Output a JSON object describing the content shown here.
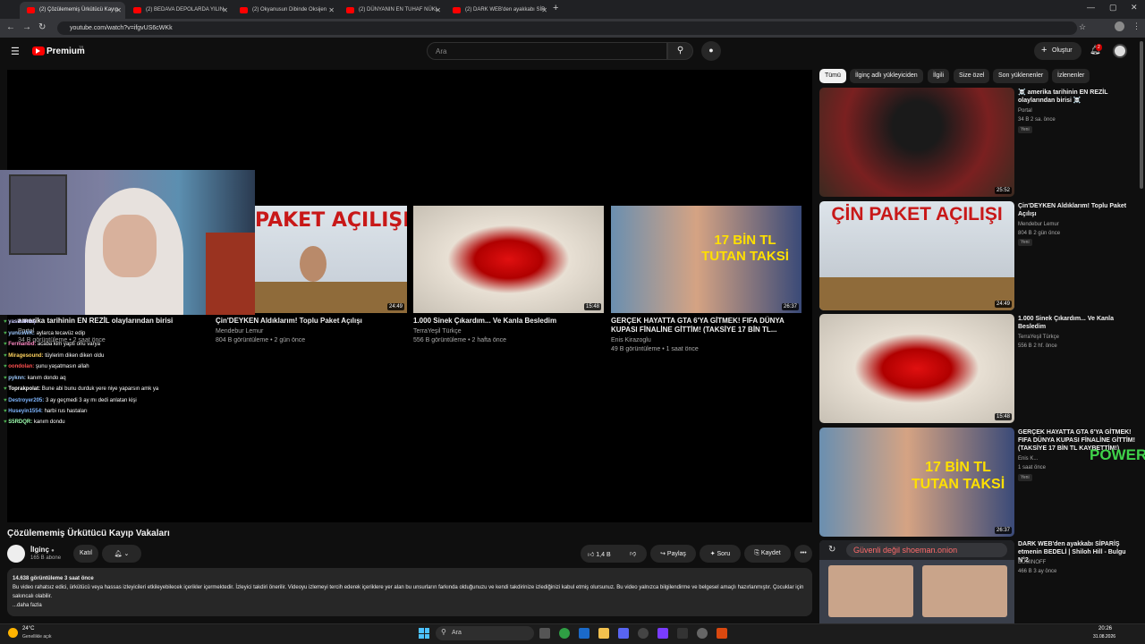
{
  "browser": {
    "tabs": [
      {
        "label": "(2) Çözülememiş Ürkütücü Kayıp"
      },
      {
        "label": "(2) BEDAVA DEPOLARDA YILIN"
      },
      {
        "label": "(2) Okyanusun Dibinde Oksijen"
      },
      {
        "label": "(2) DÜNYANIN EN TUHAF NÜKL"
      },
      {
        "label": "(2) DARK WEB'den ayakkabı SİP"
      }
    ],
    "new_tab": "+",
    "url": "youtube.com/watch?v=ifgvUS6cWKk"
  },
  "yt_header": {
    "logo": "Premium",
    "logo_sup": "TR",
    "search_placeholder": "Ara",
    "create_label": "Oluştur",
    "notif_count": "2"
  },
  "endscreen": [
    {
      "title": "Çin'DEYKEN Aldıklarım! Toplu Paket Açılışı",
      "meta": "804 B görüntüleme • 2 gün önce",
      "channel": "Mendebur Lemur",
      "duration": "24:49",
      "thumb_text": "PAKET AÇILIŞI"
    },
    {
      "title": "1.000 Sinek Çıkardım... Ve Kanla Besledim",
      "meta": "556 B görüntüleme • 2 hafta önce",
      "channel": "TerraYeşil Türkçe",
      "duration": "15:48"
    },
    {
      "title": "GERÇEK HAYATTA GTA 6'YA GİTMEK! FIFA DÜNYA KUPASI FİNALİNE GİTTİM! (TAKSİYE 17 BİN TL...",
      "meta": "49 B görüntüleme • 1 saat önce",
      "channel": "Enis Kirazoglu",
      "duration": "26:37",
      "thumb_text": "17 BİN TL TUTAN TAKSİ"
    }
  ],
  "endscreen_first": {
    "title": "amerika tarihinin EN REZİL olaylarından birisi",
    "channel": "Portal",
    "meta": "34 B görüntüleme • 2 saat önce"
  },
  "chat": [
    {
      "user": "yasinaktaş",
      "text": "",
      "color": "#c9c9ff"
    },
    {
      "user": "yunusWK:",
      "text": "aylarca tecavüz edip",
      "color": "#9ec9ff"
    },
    {
      "user": "Fermanbd:",
      "text": "acaba kim yaptı onu varya",
      "color": "#ff8ac4"
    },
    {
      "user": "Miragesound:",
      "text": "tüylerim diken diken oldu",
      "color": "#ffd25e"
    },
    {
      "user": "oondolan:",
      "text": "şunu yaşatmasın allah",
      "color": "#ff4f4f"
    },
    {
      "user": "pyknn:",
      "text": "kanım dondo aq",
      "color": "#9ecbff"
    },
    {
      "user": "Toprakpolat:",
      "text": "Bune abi bunu durduk yere niye yaparsın amk ya",
      "color": "#ffffff"
    },
    {
      "user": "Destroyer205:",
      "text": "3 ay geçmedi 3 ay mı dedi anlatan kişi",
      "color": "#7fb6ff"
    },
    {
      "user": "Huseyin1554:",
      "text": "harbi rus hastaları",
      "color": "#7fb6ff"
    },
    {
      "user": "S5RDQR:",
      "text": "kanım dondu",
      "color": "#9effb0"
    }
  ],
  "video": {
    "title": "Çözülememiş Ürkütücü Kayıp Vakaları",
    "channel": "İlginç",
    "subs": "165 B abone",
    "join": "Katıl",
    "likes": "1,4 B",
    "share": "Paylaş",
    "ask": "Soru",
    "save": "Kaydet",
    "more": "•••"
  },
  "description": {
    "stats": "14.638 görüntüleme  3 saat önce",
    "text": "Bu video rahatsız edici, ürkütücü veya hassas izleyicileri etkileyebilecek içerikler içermektedir. İzleyici takdiri önerilir. Videoyu izlemeyi tercih ederek içeriklere yer alan bu unsurların farkında olduğunuzu ve kendi takdirinize izlediğinizi kabul etmiş olursunuz. Bu video yalnızca bilgilendirme ve belgesel amaçlı hazırlanmıştır. Çocuklar için sakıncalı olabilir.",
    "more": "...daha fazla"
  },
  "filter_chips": [
    "Tümü",
    "İlginç adlı yükleyiciden",
    "İlgili",
    "Size özel",
    "Son yüklenenler",
    "İzlenenler"
  ],
  "sidebar": [
    {
      "title": "☠️ amerika tarihinin EN REZİL olaylarından birisi ☠️",
      "channel": "Portal",
      "meta": "34 B  2 sa. önce",
      "badge": "Yeni",
      "duration": "25:52"
    },
    {
      "title": "Çin'DEYKEN Aldıklarım! Toplu Paket Açılışı",
      "channel": "Mendebur Lemur",
      "meta": "804 B  2 gün önce",
      "badge": "Yeni",
      "duration": "24:49",
      "thumb_text": "ÇİN PAKET AÇILIŞI"
    },
    {
      "title": "1.000 Sinek Çıkardım... Ve Kanla Besledim",
      "channel": "TerraYeşil Türkçe",
      "meta": "556 B  2 hf. önce",
      "duration": "15:48"
    },
    {
      "title": "GERÇEK HAYATTA GTA 6'YA GİTMEK! FIFA DÜNYA KUPASI FİNALİNE GİTTİM! (TAKSİYE 17 BİN TL KAYBETTİM!)",
      "channel": "Enis K...",
      "meta": "1 saat önce",
      "badge": "Yeni",
      "duration": "26:37",
      "thumb_text": "17 BİN TL TUTAN TAKSİ"
    },
    {
      "title": "DARK WEB'den ayakkabı SİPARİŞ etmenin BEDELİ | Shiloh Hill - Bulgu N°2",
      "channel": "BUMINOFF",
      "meta": "466 B  3 ay önce",
      "thumb_text": "Güvenli değil  shoeman.onion"
    }
  ],
  "overlay_text": "POWER",
  "taskbar": {
    "weather_temp": "24°C",
    "weather_desc": "Genellikle açık",
    "search": "Ara",
    "time": "20:26",
    "date": "31.08.2026"
  },
  "colors": {
    "accent": "#ff0000",
    "bg": "#0f0f0f",
    "panel": "#272727"
  }
}
